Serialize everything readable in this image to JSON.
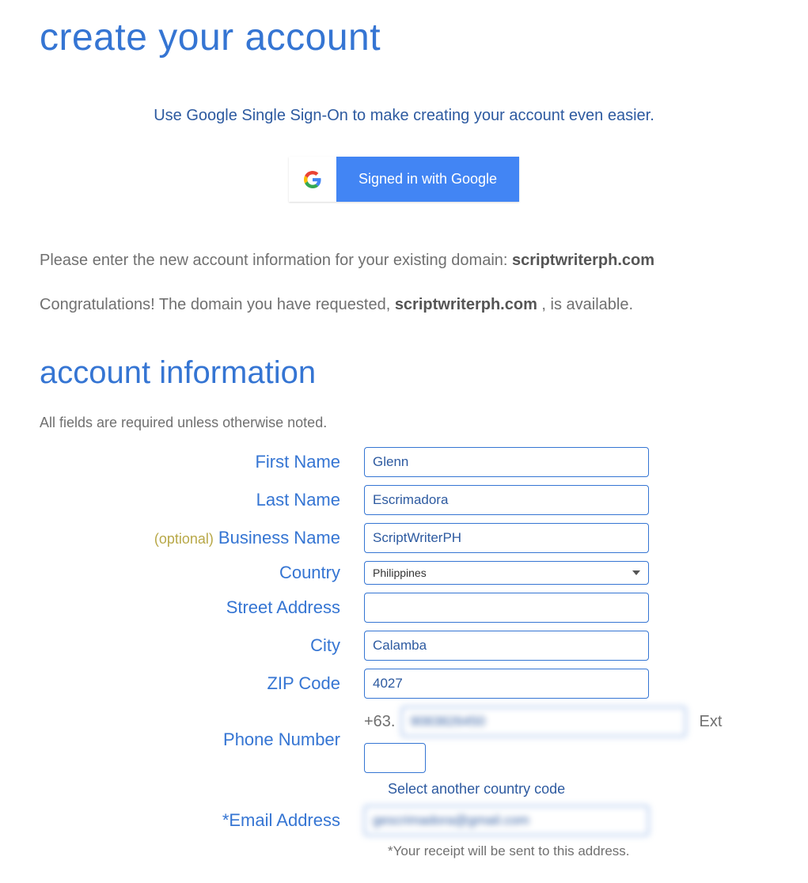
{
  "headings": {
    "main": "create your account",
    "section": "account information"
  },
  "sso": {
    "text": "Use Google Single Sign-On to make creating your account even easier.",
    "button": "Signed in with Google"
  },
  "intro": {
    "line1_pre": "Please enter the new account information for your existing domain: ",
    "line1_domain": "scriptwriterph.com",
    "line2_pre": "Congratulations! The domain you have requested, ",
    "line2_domain": "scriptwriterph.com",
    "line2_post": " , is available."
  },
  "required_note": "All fields are required unless otherwise noted.",
  "labels": {
    "first_name": "First Name",
    "last_name": "Last Name",
    "business_name": "Business Name",
    "optional": "(optional)",
    "country": "Country",
    "street_address": "Street Address",
    "city": "City",
    "zip": "ZIP Code",
    "phone": "Phone Number",
    "ext": "Ext",
    "email": "*Email Address"
  },
  "values": {
    "first_name": "Glenn",
    "last_name": "Escrimadora",
    "business_name": "ScriptWriterPH",
    "country": "Philippines",
    "street_address": "",
    "city": "Calamba",
    "zip": "4027",
    "phone_prefix": "+63.",
    "phone": "9083826450",
    "ext": "",
    "country_code_link": "Select another country code",
    "email": "gescrimadora@gmail.com",
    "receipt_note": "*Your receipt will be sent to this address."
  }
}
